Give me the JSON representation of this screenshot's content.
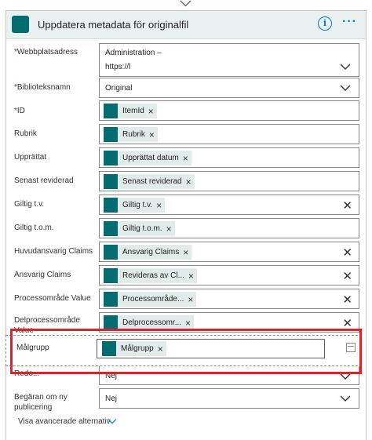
{
  "header": {
    "title": "Uppdatera metadata för originalfil",
    "info_label": "i",
    "more_label": "···"
  },
  "fields": {
    "site": {
      "label": "Webbplatsadress",
      "required": "*",
      "value_line1": "Administration –",
      "value_line2": "https://l"
    },
    "library": {
      "label": "Biblioteksnamn",
      "required": "*",
      "value": "Original"
    },
    "id": {
      "label": "ID",
      "required": "*",
      "token": "ItemId"
    },
    "rubrik": {
      "label": "Rubrik",
      "token": "Rubrik"
    },
    "upprattat": {
      "label": "Upprättat",
      "token": "Upprättat datum"
    },
    "senast": {
      "label": "Senast reviderad",
      "token": "Senast reviderad"
    },
    "giltig_tv": {
      "label": "Giltig t.v.",
      "token": "Giltig t.v."
    },
    "giltig_tom": {
      "label": "Giltig t.o.m.",
      "token": "Giltig t.o.m."
    },
    "huvudansvarig": {
      "label": "Huvudansvarig Claims",
      "token": "Ansvarig Claims"
    },
    "ansvarig": {
      "label": "Ansvarig Claims",
      "token": "Revideras av Cl..."
    },
    "processomrade": {
      "label": "Processområde Value",
      "token": "Processområde..."
    },
    "delprocessomrade": {
      "label": "Delprocessområde Value",
      "token": "Delprocessomr..."
    },
    "malgrupp": {
      "label": "Målgrupp",
      "token": "Målgrupp"
    },
    "obscured": {
      "label": "Redo...",
      "value": "Nej"
    },
    "begaran": {
      "label": "Begäran om ny publicering",
      "value": "Nej"
    }
  },
  "advanced": {
    "label": "Visa avancerade alternativ"
  },
  "colors": {
    "sharepoint": "#036c70",
    "accent": "#0078d4",
    "required": "#a4262c",
    "highlight": "#e02030",
    "token_bg": "#e1ebea",
    "header_bg": "#e9f2f1"
  },
  "token_x": "×",
  "clear_x": "✕"
}
